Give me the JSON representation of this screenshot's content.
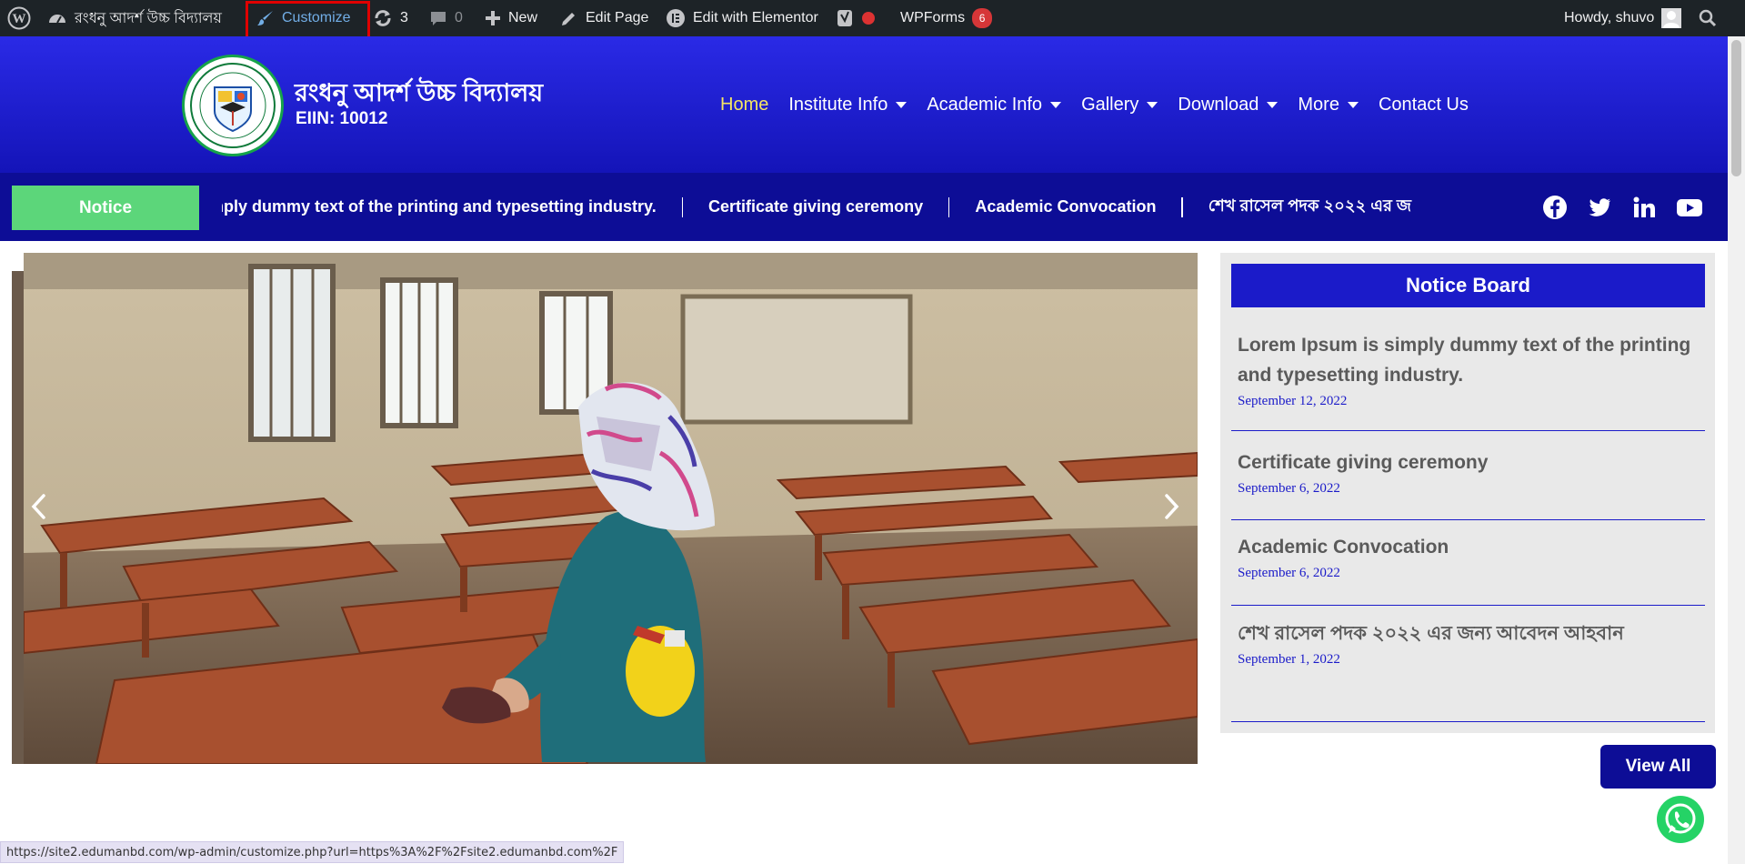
{
  "adminbar": {
    "site_name": "রংধনু আদর্শ উচ্চ বিদ্যালয়",
    "customize": "Customize",
    "updates_count": "3",
    "comments_count": "0",
    "new_label": "New",
    "edit_page": "Edit Page",
    "edit_elementor": "Edit with Elementor",
    "wpforms": "WPForms",
    "wpforms_badge": "6",
    "howdy": "Howdy, shuvo",
    "customize_highlight_color": "#e00000"
  },
  "header": {
    "title": "রংধনু আদর্শ উচ্চ বিদ্যালয়",
    "eiin": "EIIN: 10012",
    "nav": [
      {
        "label": "Home"
      },
      {
        "label": "Institute Info"
      },
      {
        "label": "Academic Info"
      },
      {
        "label": "Gallery"
      },
      {
        "label": "Download"
      },
      {
        "label": "More"
      },
      {
        "label": "Contact Us"
      }
    ]
  },
  "ticker": {
    "label": "Notice",
    "items": [
      ": simply dummy text of the printing and typesetting industry.",
      "Certificate giving ceremony",
      "Academic Convocation",
      "শেখ রাসেল পদক ২০২২ এর জ"
    ]
  },
  "socials": [
    "facebook-icon",
    "twitter-icon",
    "linkedin-icon",
    "youtube-icon"
  ],
  "board": {
    "title": "Notice Board",
    "items": [
      {
        "title": "Lorem Ipsum is simply dummy text of the printing and typesetting industry.",
        "date": "September 12, 2022"
      },
      {
        "title": "Certificate giving ceremony",
        "date": "September 6, 2022"
      },
      {
        "title": "Academic Convocation",
        "date": "September 6, 2022"
      },
      {
        "title": "শেখ রাসেল পদক ২০২২ এর জন্য আবেদন আহবান",
        "date": "September 1, 2022"
      }
    ],
    "view_all": "View All"
  },
  "status_url": "https://site2.edumanbd.com/wp-admin/customize.php?url=https%3A%2F%2Fsite2.edumanbd.com%2F",
  "colors": {
    "header_blue": "#1414b8",
    "notice_green": "#5cd67a",
    "nav_active": "#f5e663",
    "board_blue": "#1b1bc9"
  }
}
